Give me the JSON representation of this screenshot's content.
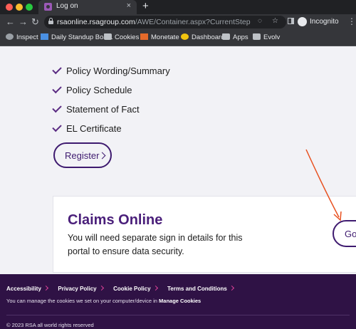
{
  "browser": {
    "tab_title": "Log on",
    "tab_close": "×",
    "new_tab": "+",
    "url_host": "rsaonline.rsagroup.com",
    "url_path": "/AWE/Container.aspx?CurrentStep=Login&C...",
    "profile_label": "Incognito",
    "nav": {
      "back": "←",
      "forward": "→",
      "reload": "↻",
      "more": "⋮"
    },
    "bookmarks": [
      {
        "label": "Inspect",
        "icon": "globe-icon"
      },
      {
        "label": "Daily Standup Boa...",
        "icon": "board-icon"
      },
      {
        "label": "Cookies",
        "icon": "folder-icon"
      },
      {
        "label": "Monetate",
        "icon": "monetate-icon"
      },
      {
        "label": "Dashboard",
        "icon": "dashboard-icon"
      },
      {
        "label": "Apps",
        "icon": "folder-icon"
      },
      {
        "label": "Evolv",
        "icon": "folder-icon"
      }
    ]
  },
  "page": {
    "checklist": [
      "Policy Wording/Summary",
      "Policy Schedule",
      "Statement of Fact",
      "EL Certificate"
    ],
    "register_label": "Register",
    "claims": {
      "title": "Claims Online",
      "description": "You will need separate sign in details for this portal to ensure data security.",
      "go_label": "Go"
    },
    "annotation_color": "#e8501f"
  },
  "footer": {
    "links": [
      "Accessibility",
      "Privacy Policy",
      "Cookie Policy",
      "Terms and Conditions"
    ],
    "cookie_text": "You can manage the cookies we set on your computer/device in",
    "cookie_link": "Manage Cookies",
    "copyright": "© 2023 RSA all world rights reserved",
    "accent_color": "#e0409a",
    "background_color": "#2f1245"
  }
}
